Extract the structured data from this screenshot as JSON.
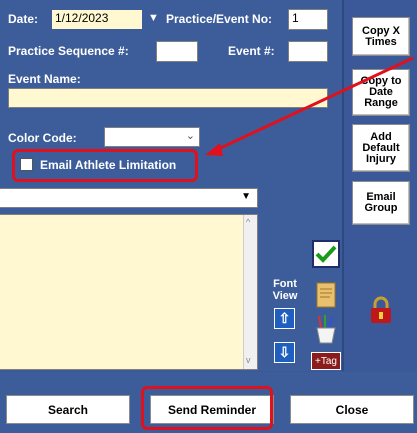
{
  "form": {
    "date_label": "Date:",
    "date_value": "1/12/2023",
    "practice_event_label": "Practice/Event No:",
    "practice_event_value": "1",
    "practice_seq_label": "Practice Sequence #:",
    "event_num_label": "Event #:",
    "event_name_label": "Event Name:",
    "color_code_label": "Color Code:",
    "email_limitation_label": "Email Athlete Limitation",
    "font_view_label": "Font View",
    "tag_label": "+Tag"
  },
  "right_buttons": {
    "copy_times": "Copy X Times",
    "copy_range": "Copy to Date Range",
    "add_injury": "Add Default Injury",
    "email_group": "Email Group"
  },
  "bottom_buttons": {
    "search": "Search",
    "send_reminder": "Send Reminder",
    "close": "Close"
  },
  "colors": {
    "panel_blue": "#3d5d9a",
    "highlight_red": "#e0101c",
    "field_yellow": "#fff8d0"
  }
}
